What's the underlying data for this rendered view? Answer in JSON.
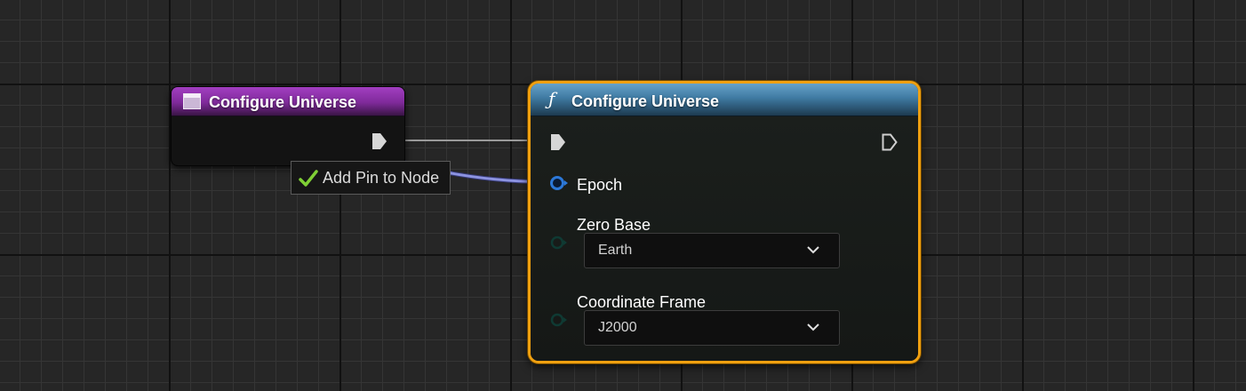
{
  "left_node": {
    "title": "Configure Universe",
    "icon": "window-icon",
    "header_color": "#8a2fa6"
  },
  "tooltip": {
    "label": "Add Pin to Node",
    "icon": "checkmark-icon",
    "icon_color": "#6fbf2a"
  },
  "right_node": {
    "title": "Configure Universe",
    "function_icon": "ƒ",
    "header_color": "#4a86ae",
    "selection_color": "#f0a010",
    "pins": {
      "epoch_label": "Epoch",
      "zero_base_label": "Zero Base",
      "zero_base_value": "Earth",
      "coordinate_frame_label": "Coordinate Frame",
      "coordinate_frame_value": "J2000"
    },
    "struct_pin_color": "#1f5fae"
  },
  "wire_color": "#8c93e0"
}
